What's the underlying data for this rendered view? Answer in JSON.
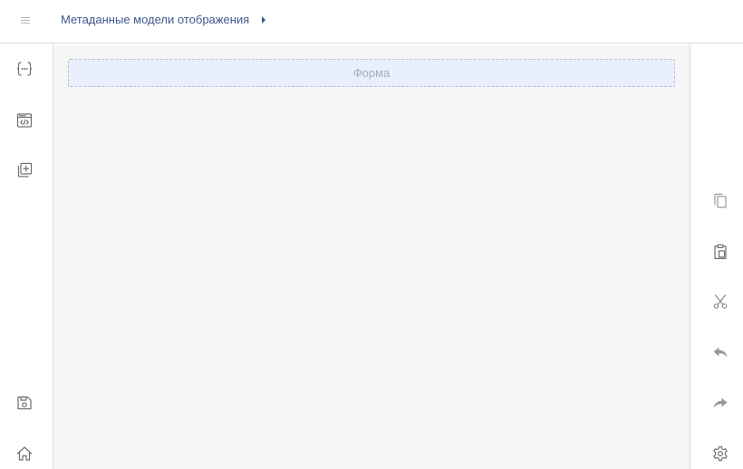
{
  "header": {
    "menu_icon": "hamburger-icon",
    "breadcrumb": {
      "items": [
        "Метаданные модели отображения"
      ]
    }
  },
  "left_toolbar": {
    "icons": [
      "braces-code-icon",
      "code-window-icon",
      "add-layer-icon",
      "save-icon",
      "home-icon"
    ]
  },
  "right_toolbar": {
    "icons": [
      "copy-icon",
      "paste-icon",
      "cut-icon",
      "undo-icon",
      "redo-icon",
      "settings-icon"
    ]
  },
  "canvas": {
    "form_placeholder": "Форма"
  },
  "colors": {
    "breadcrumb_link": "#3d5a8a",
    "drop_zone_bg": "#e9effc",
    "canvas_bg": "#f6f6f6",
    "icon_gray": "#8a8a8a"
  }
}
